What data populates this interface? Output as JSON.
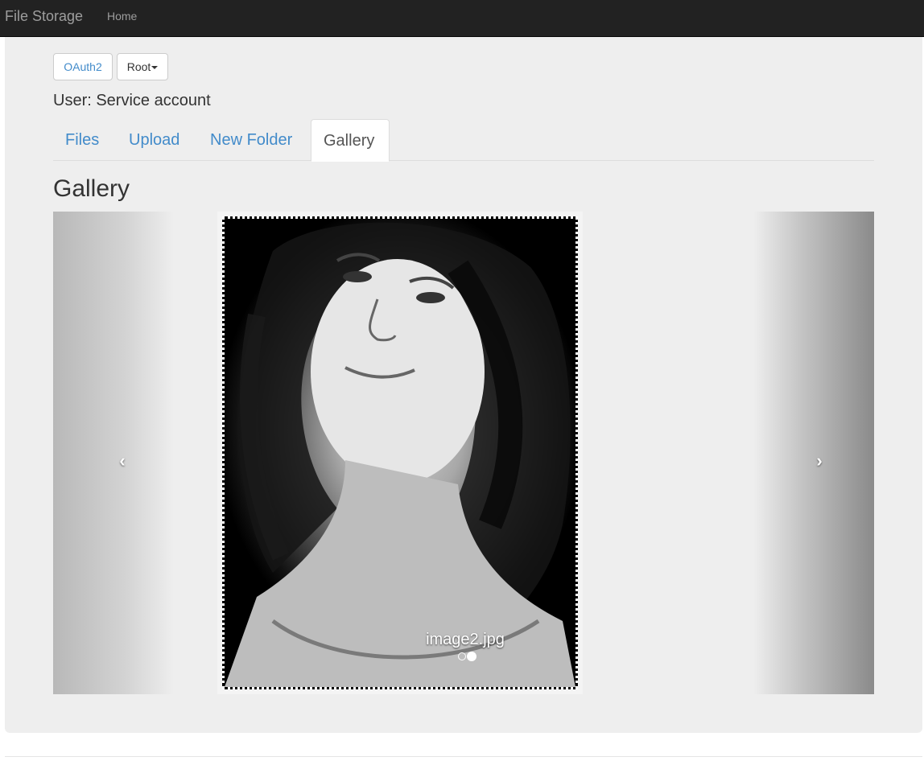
{
  "navbar": {
    "brand": "File Storage",
    "links": [
      "Home"
    ]
  },
  "toolbar": {
    "oauth_label": "OAuth2",
    "root_label": "Root"
  },
  "user": {
    "line": "User: Service account"
  },
  "tabs": [
    {
      "label": "Files",
      "active": false
    },
    {
      "label": "Upload",
      "active": false
    },
    {
      "label": "New Folder",
      "active": false
    },
    {
      "label": "Gallery",
      "active": true
    }
  ],
  "gallery": {
    "heading": "Gallery",
    "caption": "image2.jpg",
    "slide_count": 2,
    "active_slide": 2,
    "prev_icon": "chevron-left-icon",
    "next_icon": "chevron-right-icon"
  },
  "colors": {
    "navbar_bg": "#222222",
    "link": "#428bca",
    "panel_bg": "#eeeeee"
  }
}
